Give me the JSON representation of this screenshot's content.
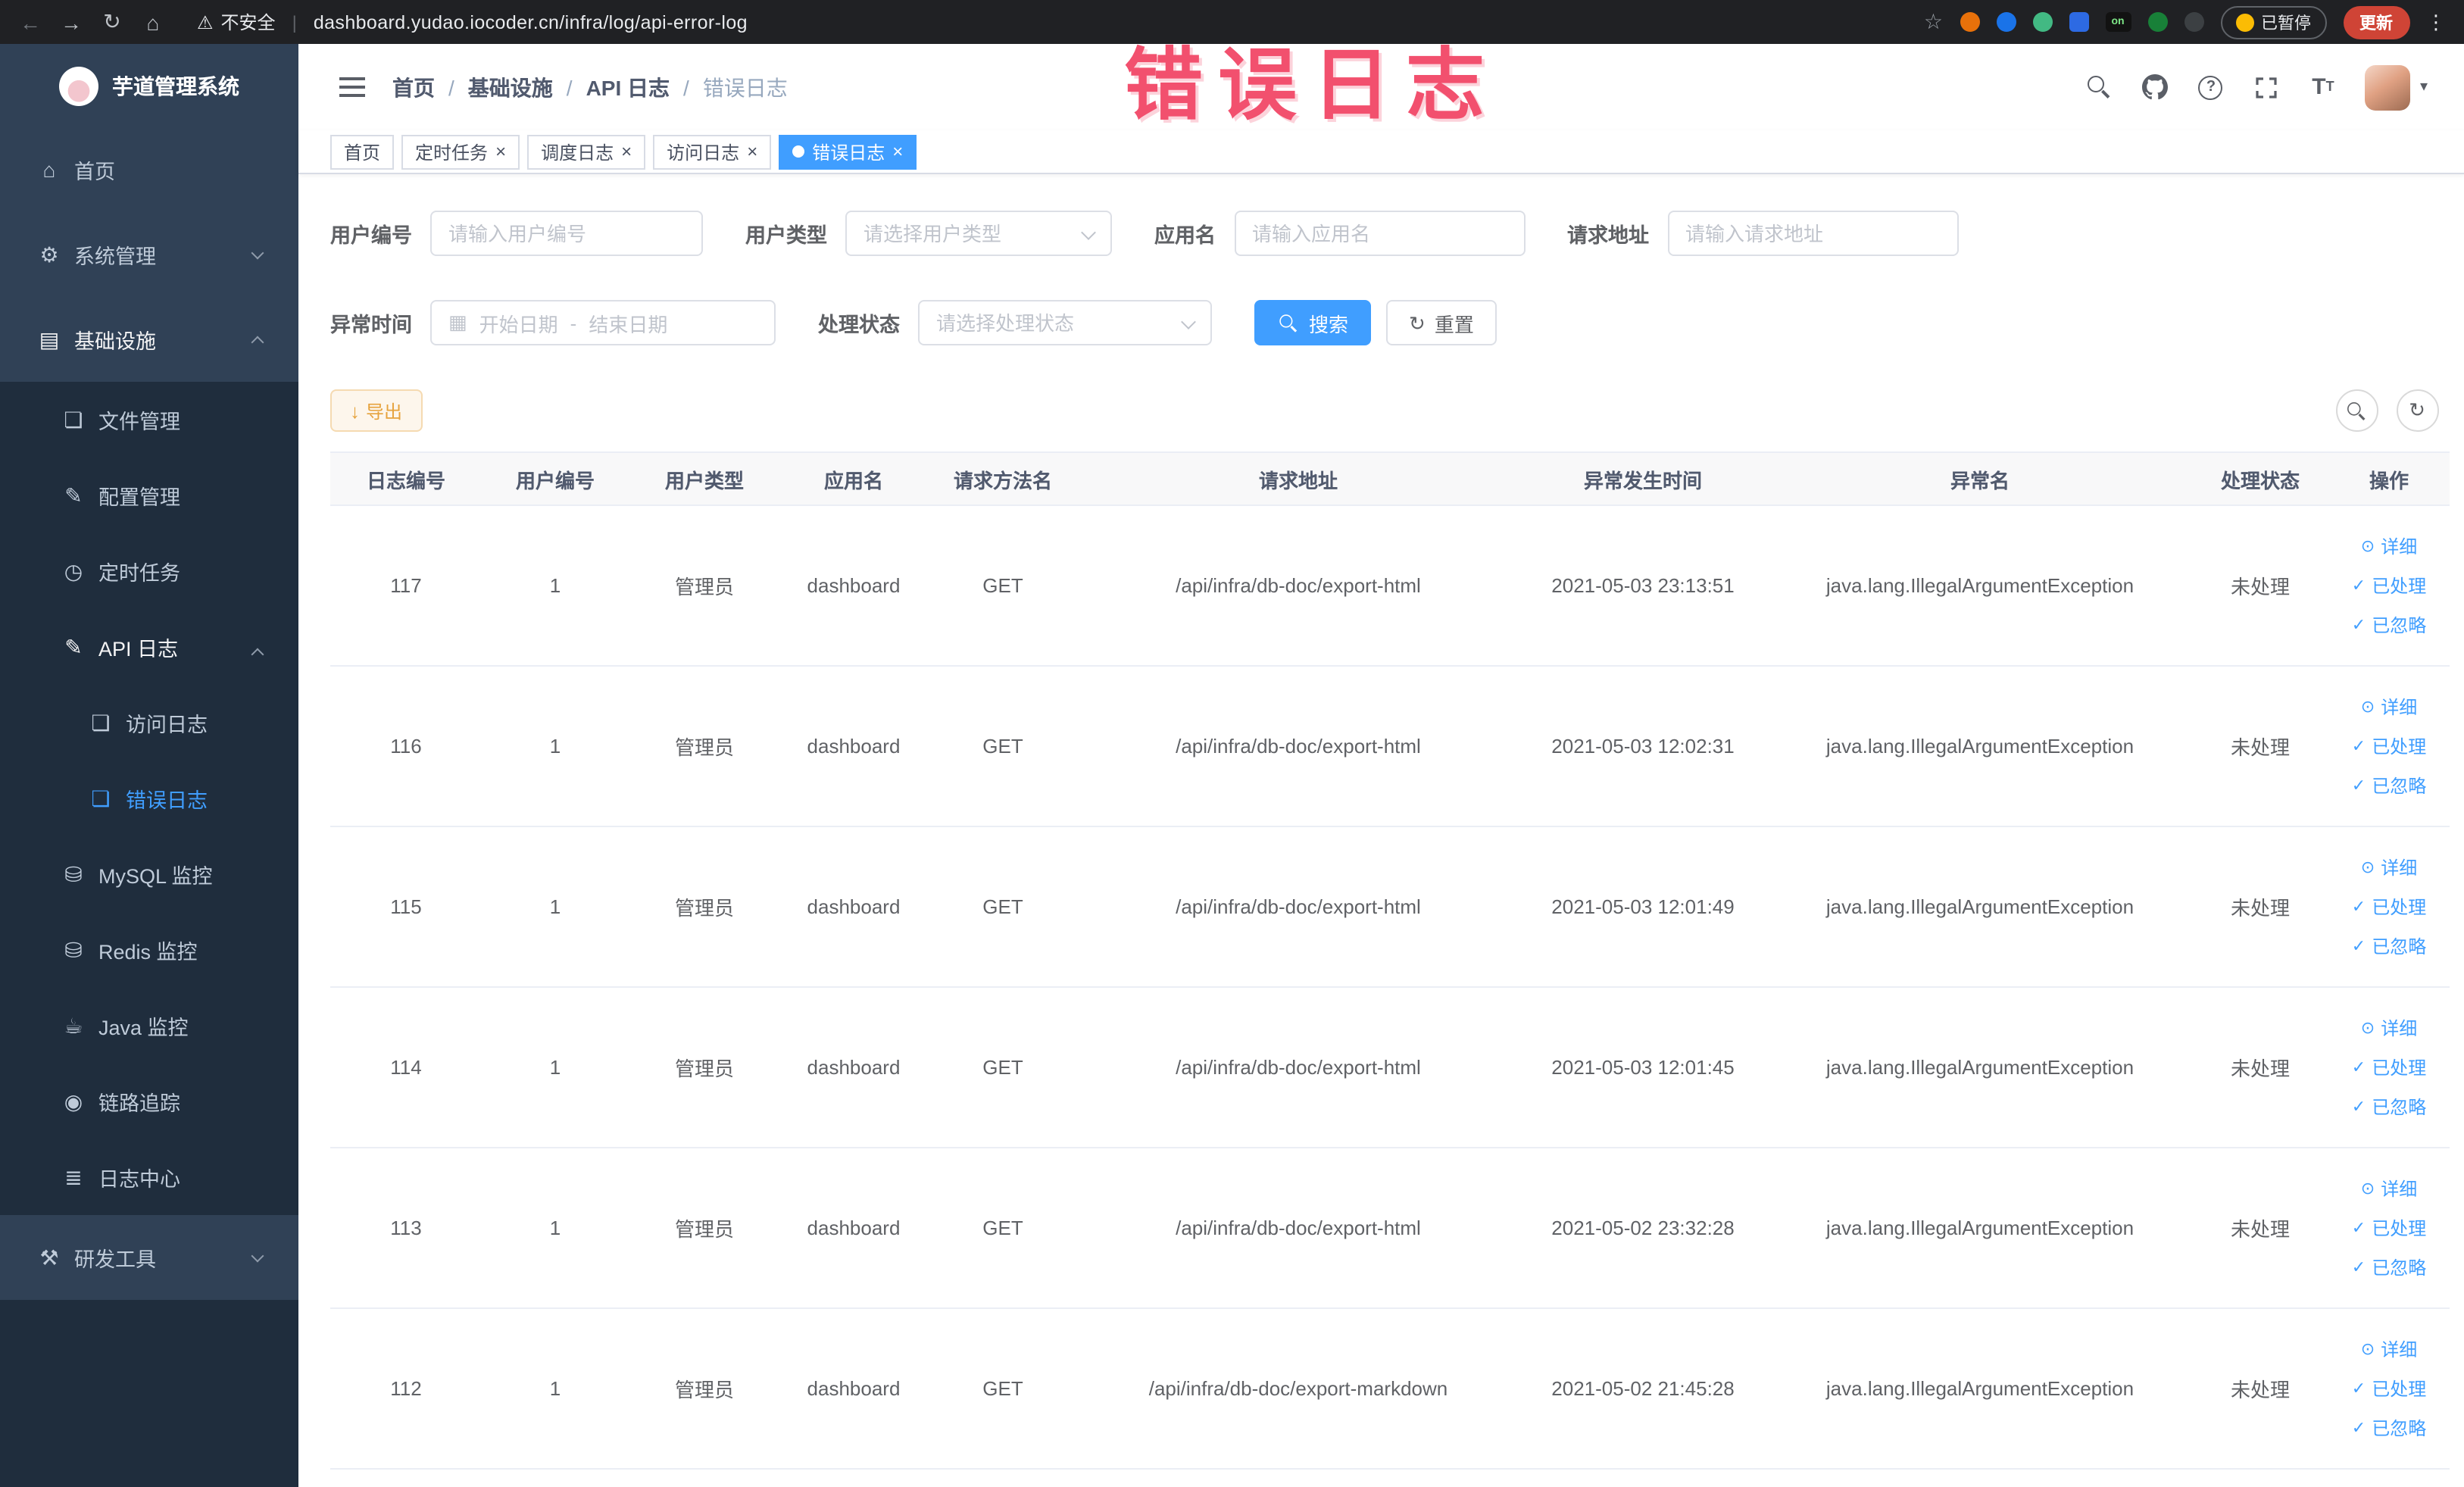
{
  "browser": {
    "security_label": "不安全",
    "url": "dashboard.yudao.iocoder.cn/infra/log/api-error-log",
    "paused_badge": "已暂停",
    "update_button": "更新"
  },
  "annotation": {
    "text": "错误日志",
    "color": "#f2506e"
  },
  "icons": {
    "back": "←",
    "forward": "→",
    "reload": "↻",
    "browser_home": "⌂",
    "warning": "⚠",
    "star": "☆",
    "kebab": "⋮",
    "caret": "▾",
    "close": "×",
    "download": "↓",
    "refresh": "↻",
    "calendar": "▦",
    "eye": "⊙",
    "check": "✓",
    "home": "⌂",
    "system": "⚙",
    "infra": "▤",
    "file": "❏",
    "config": "✎",
    "timer": "◷",
    "api_log": "✎",
    "access_log": "❏",
    "error_log": "❏",
    "mysql": "⛁",
    "redis": "⛁",
    "java": "☕",
    "trace": "◉",
    "log_center": "≣",
    "devtools": "⚒"
  },
  "sidebar": {
    "title": "芋道管理系统",
    "items": [
      {
        "label": "首页"
      },
      {
        "label": "系统管理"
      },
      {
        "label": "基础设施"
      },
      {
        "label": "文件管理"
      },
      {
        "label": "配置管理"
      },
      {
        "label": "定时任务"
      },
      {
        "label": "API 日志"
      },
      {
        "label": "访问日志"
      },
      {
        "label": "错误日志"
      },
      {
        "label": "MySQL 监控"
      },
      {
        "label": "Redis 监控"
      },
      {
        "label": "Java 监控"
      },
      {
        "label": "链路追踪"
      },
      {
        "label": "日志中心"
      },
      {
        "label": "研发工具"
      }
    ]
  },
  "breadcrumb": {
    "items": [
      "首页",
      "基础设施",
      "API 日志",
      "错误日志"
    ]
  },
  "tabs": [
    {
      "label": "首页"
    },
    {
      "label": "定时任务"
    },
    {
      "label": "调度日志"
    },
    {
      "label": "访问日志"
    },
    {
      "label": "错误日志"
    }
  ],
  "filters": {
    "user_id_label": "用户编号",
    "user_id_placeholder": "请输入用户编号",
    "user_type_label": "用户类型",
    "user_type_placeholder": "请选择用户类型",
    "app_name_label": "应用名",
    "app_name_placeholder": "请输入应用名",
    "request_url_label": "请求地址",
    "request_url_placeholder": "请输入请求地址",
    "time_label": "异常时间",
    "time_start_placeholder": "开始日期",
    "time_separator": "-",
    "time_end_placeholder": "结束日期",
    "status_label": "处理状态",
    "status_placeholder": "请选择处理状态",
    "search_button": "搜索",
    "reset_button": "重置"
  },
  "toolbar": {
    "export_button": "导出"
  },
  "table": {
    "headers": [
      "日志编号",
      "用户编号",
      "用户类型",
      "应用名",
      "请求方法名",
      "请求地址",
      "异常发生时间",
      "异常名",
      "处理状态",
      "操作"
    ],
    "actions": {
      "detail": "详细",
      "process": "已处理",
      "ignore": "已忽略"
    },
    "rows": [
      {
        "id": "117",
        "user_id": "1",
        "user_type": "管理员",
        "app_name": "dashboard",
        "method": "GET",
        "url": "/api/infra/db-doc/export-html",
        "time": "2021-05-03 23:13:51",
        "exception": "java.lang.IllegalArgumentException",
        "status": "未处理"
      },
      {
        "id": "116",
        "user_id": "1",
        "user_type": "管理员",
        "app_name": "dashboard",
        "method": "GET",
        "url": "/api/infra/db-doc/export-html",
        "time": "2021-05-03 12:02:31",
        "exception": "java.lang.IllegalArgumentException",
        "status": "未处理"
      },
      {
        "id": "115",
        "user_id": "1",
        "user_type": "管理员",
        "app_name": "dashboard",
        "method": "GET",
        "url": "/api/infra/db-doc/export-html",
        "time": "2021-05-03 12:01:49",
        "exception": "java.lang.IllegalArgumentException",
        "status": "未处理"
      },
      {
        "id": "114",
        "user_id": "1",
        "user_type": "管理员",
        "app_name": "dashboard",
        "method": "GET",
        "url": "/api/infra/db-doc/export-html",
        "time": "2021-05-03 12:01:45",
        "exception": "java.lang.IllegalArgumentException",
        "status": "未处理"
      },
      {
        "id": "113",
        "user_id": "1",
        "user_type": "管理员",
        "app_name": "dashboard",
        "method": "GET",
        "url": "/api/infra/db-doc/export-html",
        "time": "2021-05-02 23:32:28",
        "exception": "java.lang.IllegalArgumentException",
        "status": "未处理"
      },
      {
        "id": "112",
        "user_id": "1",
        "user_type": "管理员",
        "app_name": "dashboard",
        "method": "GET",
        "url": "/api/infra/db-doc/export-markdown",
        "time": "2021-05-02 21:45:28",
        "exception": "java.lang.IllegalArgumentException",
        "status": "未处理"
      }
    ]
  },
  "colors": {
    "accent": "#409eff",
    "warning": "#e6a23c",
    "sidebar_bg": "#304156",
    "submenu_bg": "#1f2d3d"
  }
}
